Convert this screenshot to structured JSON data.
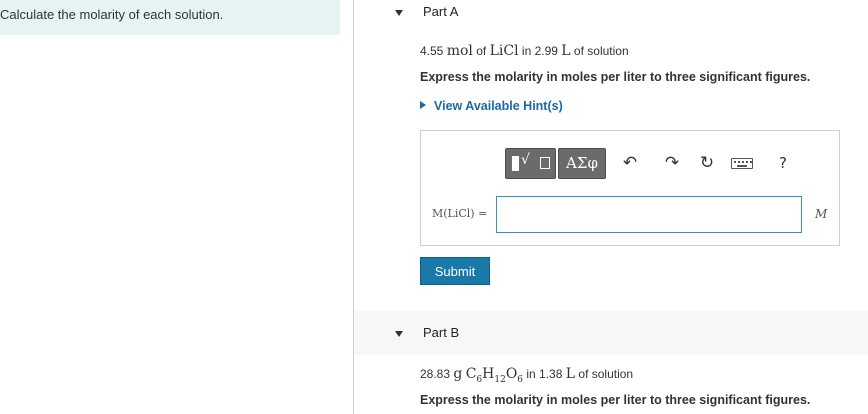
{
  "intro": "Calculate the molarity of each solution.",
  "partA": {
    "title": "Part A",
    "given_amount": "4.55",
    "given_unit": "mol",
    "given_of": "of",
    "given_compound": "LiCl",
    "given_in": "in 2.99",
    "given_volume_unit": "L",
    "given_suffix": "of solution",
    "instruction": "Express the molarity in moles per liter to three significant figures.",
    "hint_label": "View Available Hint(s)",
    "toolbar": {
      "greek_label": "ΑΣφ",
      "help_label": "?"
    },
    "answer_label": "M(LiCl) =",
    "answer_value": "",
    "answer_unit": "M",
    "submit_label": "Submit"
  },
  "partB": {
    "title": "Part B",
    "given_amount": "28.83",
    "given_unit": "g",
    "given_compound_html": "C6H12O6",
    "given_in": "in 1.38",
    "given_volume_unit": "L",
    "given_suffix": "of solution",
    "instruction": "Express the molarity in moles per liter to three significant figures."
  },
  "colors": {
    "accent": "#1979a8",
    "hint": "#1b6aa5",
    "intro_bg": "#e6f3f5"
  }
}
